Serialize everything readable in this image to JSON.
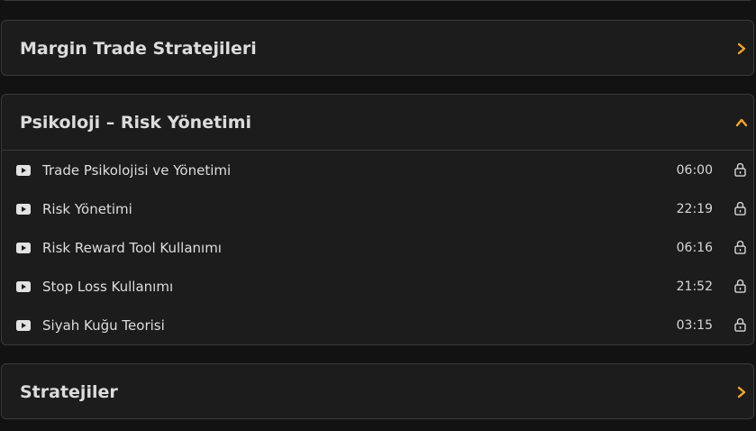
{
  "accent_color": "#f5a623",
  "sections": {
    "margin": {
      "title": "Margin Trade Stratejileri",
      "icon": "chevron-right-icon"
    },
    "psikoloji": {
      "title": "Psikoloji – Risk Yönetimi",
      "icon": "chevron-up-icon",
      "lessons": [
        {
          "title": "Trade Psikolojisi ve Yönetimi",
          "duration": "06:00"
        },
        {
          "title": "Risk Yönetimi",
          "duration": "22:19"
        },
        {
          "title": "Risk Reward Tool Kullanımı",
          "duration": "06:16"
        },
        {
          "title": "Stop Loss Kullanımı",
          "duration": "21:52"
        },
        {
          "title": "Siyah Kuğu Teorisi",
          "duration": "03:15"
        }
      ]
    },
    "stratejiler": {
      "title": "Stratejiler",
      "icon": "chevron-right-icon"
    }
  }
}
